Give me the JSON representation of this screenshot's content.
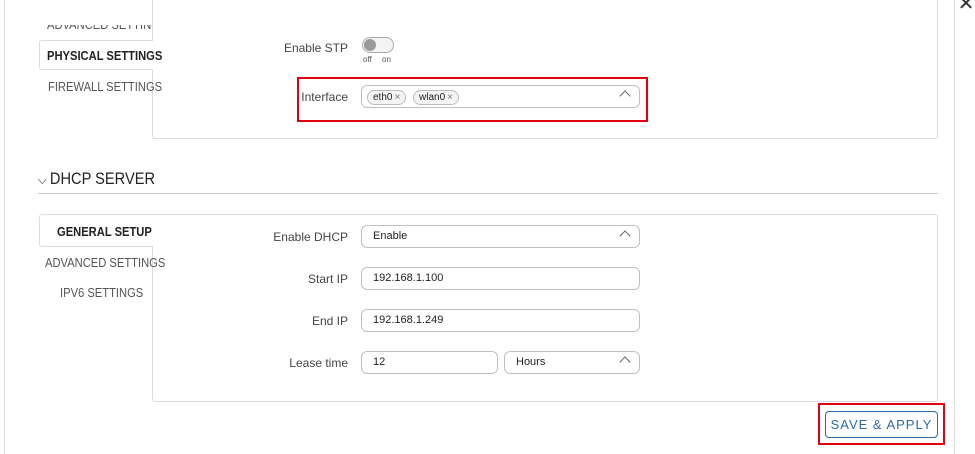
{
  "dialog": {
    "close_icon": "close-icon"
  },
  "bridge": {
    "tabs": [
      {
        "label": "ADVANCED SETTINGS"
      },
      {
        "label": "PHYSICAL SETTINGS"
      },
      {
        "label": "FIREWALL SETTINGS"
      }
    ],
    "stp": {
      "label": "Enable STP",
      "off": "off",
      "on": "on",
      "enabled": false
    },
    "interface": {
      "label": "Interface",
      "chips": [
        "eth0",
        "wlan0"
      ],
      "remove_glyph": "×"
    }
  },
  "dhcp": {
    "title": "DHCP SERVER",
    "tabs": [
      {
        "label": "GENERAL SETUP"
      },
      {
        "label": "ADVANCED SETTINGS"
      },
      {
        "label": "IPV6 SETTINGS"
      }
    ],
    "enable": {
      "label": "Enable DHCP",
      "value": "Enable"
    },
    "start_ip": {
      "label": "Start IP",
      "value": "192.168.1.100"
    },
    "end_ip": {
      "label": "End IP",
      "value": "192.168.1.249"
    },
    "lease": {
      "label": "Lease time",
      "value": "12",
      "unit": "Hours"
    }
  },
  "actions": {
    "save_label": "SAVE & APPLY"
  },
  "colors": {
    "highlight": "#e0000f",
    "accent": "#2f6aa0"
  }
}
